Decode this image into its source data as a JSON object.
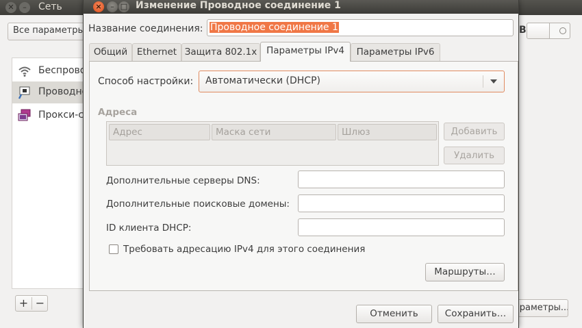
{
  "background_window": {
    "title": "Сеть",
    "all_settings_label": "Все параметры",
    "side_letter": "B",
    "items": [
      {
        "label": "Беспроводная сеть",
        "icon": "wifi-icon"
      },
      {
        "label": "Проводное",
        "icon": "wired-network-icon"
      },
      {
        "label": "Прокси-сервер",
        "icon": "proxy-icon"
      }
    ],
    "add_label": "+",
    "remove_label": "−",
    "options_label": "Параметры..."
  },
  "dialog": {
    "title": "Изменение Проводное соединение 1",
    "name_label": "Название соединения:",
    "name_value": "Проводное соединение 1",
    "tabs": [
      {
        "label": "Общий"
      },
      {
        "label": "Ethernet"
      },
      {
        "label": "Защита 802.1x"
      },
      {
        "label": "Параметры IPv4",
        "active": true
      },
      {
        "label": "Параметры IPv6"
      }
    ],
    "method_label": "Способ настройки:",
    "method_value": "Автоматически (DHCP)",
    "addresses_heading": "Адреса",
    "columns": [
      "Адрес",
      "Маска сети",
      "Шлюз"
    ],
    "add_button": "Добавить",
    "remove_button": "Удалить",
    "dns_label": "Дополнительные серверы DNS:",
    "dns_value": "",
    "search_domains_label": "Дополнительные поисковые домены:",
    "search_domains_value": "",
    "dhcp_client_id_label": "ID клиента DHCP:",
    "dhcp_client_id_value": "",
    "require_ipv4_label": "Требовать адресацию IPv4 для этого соединения",
    "require_ipv4_checked": false,
    "routes_button": "Маршруты…",
    "cancel_button": "Отменить",
    "save_button": "Сохранить…"
  },
  "colors": {
    "accent": "#f07746",
    "titlebar": "#3c3b37",
    "close_button": "#df4b16"
  }
}
